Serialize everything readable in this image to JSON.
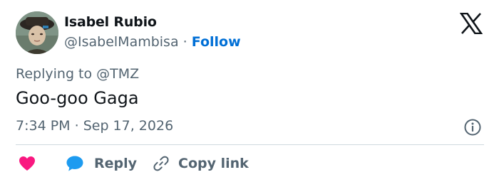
{
  "author": {
    "name": "Isabel Rubio",
    "handle": "@IsabelMambisa",
    "separator": "·",
    "follow_label": "Follow"
  },
  "reply_context": {
    "prefix": "Replying to",
    "mention": "@TMZ"
  },
  "tweet": {
    "text": "Goo-goo Gaga",
    "time": "7:34 PM",
    "separator": "·",
    "date": "Sep 17, 2026"
  },
  "actions": {
    "like_icon": "heart-icon",
    "reply_icon": "speech-bubble-icon",
    "reply_label": "Reply",
    "copy_icon": "link-icon",
    "copy_label": "Copy link"
  },
  "icons": {
    "brand": "x-logo-icon",
    "info": "info-icon"
  },
  "colors": {
    "text": "#0f1419",
    "secondary": "#536471",
    "follow": "#006fd6",
    "like": "#f91880",
    "reply": "#1d9bf0",
    "divider": "#cfd9de"
  }
}
